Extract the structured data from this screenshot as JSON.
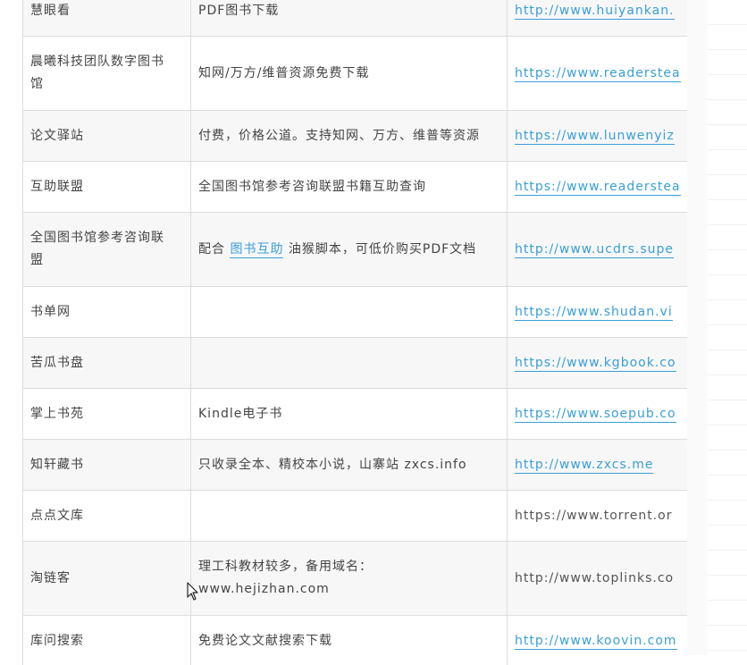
{
  "rows": [
    {
      "name": "慧眼看",
      "desc": "PDF图书下载",
      "url": "http://www.huiyankan.",
      "linked": true
    },
    {
      "name": "晨曦科技团队数字图书馆",
      "desc": "知网/万方/维普资源免费下载",
      "url": "https://www.readerstea",
      "linked": true
    },
    {
      "name": "论文驿站",
      "desc": "付费，价格公道。支持知网、万方、维普等资源",
      "url": "https://www.lunwenyiz",
      "linked": true
    },
    {
      "name": "互助联盟",
      "desc": "全国图书馆参考咨询联盟书籍互助查询",
      "url": "https://www.readerstea",
      "linked": true
    },
    {
      "name": "全国图书馆参考咨询联盟",
      "desc_pre": "配合",
      "desc_link": "图书互助",
      "desc_post": "油猴脚本，可低价购买PDF文档",
      "url": "http://www.ucdrs.supe",
      "linked": true
    },
    {
      "name": "书单网",
      "desc": "",
      "url": "https://www.shudan.vi",
      "linked": true
    },
    {
      "name": "苦瓜书盘",
      "desc": "",
      "url": "https://www.kgbook.co",
      "linked": true
    },
    {
      "name": "掌上书苑",
      "desc": "Kindle电子书",
      "url": "https://www.soepub.co",
      "linked": true
    },
    {
      "name": "知轩藏书",
      "desc": "只收录全本、精校本小说，山寨站 zxcs.info",
      "url": "http://www.zxcs.me",
      "linked": true
    },
    {
      "name": "点点文库",
      "desc": "",
      "url": "https://www.torrent.or",
      "linked": false
    },
    {
      "name": "淘链客",
      "desc": "理工科教材较多，备用域名：www.hejizhan.com",
      "url": "http://www.toplinks.co",
      "linked": false
    },
    {
      "name": "库问搜索",
      "desc": "免费论文文献搜索下载",
      "url": "http://www.koovin.com",
      "linked": true
    }
  ],
  "colors": {
    "link": "#3a9fd6",
    "border": "#dcdcdc",
    "row_alt": "#f7f7f7"
  },
  "icons": {
    "cursor": "mouse-pointer-icon"
  }
}
